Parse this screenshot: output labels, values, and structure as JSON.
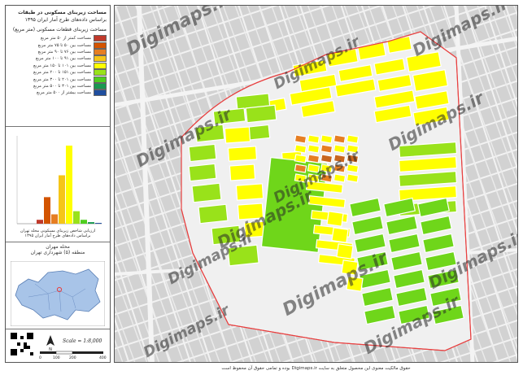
{
  "legend": {
    "title_line1": "مساحت زیربنای مسکونی در طبقات",
    "title_line2": "براساس داده‌های طرح آمار ایران ۱۳۹۵",
    "subtitle": "مساحت زیربنای قطعات مسکونی (متر مربع)",
    "items": [
      {
        "label": "مساحت کمتر از ۵۰ متر مربع",
        "color": "#c0392b"
      },
      {
        "label": "مساحت بین ۵۰ تا ۷۵ متر مربع",
        "color": "#d35400"
      },
      {
        "label": "مساحت بین ۷۶ تا ۹۰ متر مربع",
        "color": "#e67e22"
      },
      {
        "label": "مساحت بین ۹۱ تا ۱۰۰ متر مربع",
        "color": "#f5c518"
      },
      {
        "label": "مساحت بین ۱۰۱ تا ۱۵۰ متر مربع",
        "color": "#ffff00"
      },
      {
        "label": "مساحت بین ۱۵۱ تا ۲۰۰ متر مربع",
        "color": "#99e21a"
      },
      {
        "label": "مساحت بین ۲۰۱ تا ۳۰۰ متر مربع",
        "color": "#4fce1e"
      },
      {
        "label": "مساحت بین ۳۰۱ تا ۵۰۰ متر مربع",
        "color": "#1a9850"
      },
      {
        "label": "مساحت بیشتر از ۵۰۰ متر مربع",
        "color": "#1f4e9e"
      }
    ]
  },
  "histogram": {
    "caption_line1": "ارزیابی شاخص زیربنای مسکونی محله تهران",
    "caption_line2": "براساس داده‌های طرح آمار ایران ۱۳۹۵"
  },
  "locator": {
    "title_line1": "محله مهران",
    "title_line2": "منطقه (۵) شهرداری تهران"
  },
  "scale": {
    "text": "Scale = 1:8,000",
    "ticks": [
      "0",
      "100",
      "200",
      "400"
    ]
  },
  "footer": {
    "text": "حقوق مالکیت معنوی این محصول متعلق به سایت Digimaps.ir بوده و تمامی حقوق آن محفوظ است"
  },
  "watermark": {
    "text": "Digimaps.ir"
  },
  "colors": {
    "yellow": "#ffff00",
    "green_light": "#99e21a",
    "green": "#6fd61a",
    "orange": "#e67e22",
    "dark_orange": "#c8651e",
    "boundary": "#e84040"
  }
}
